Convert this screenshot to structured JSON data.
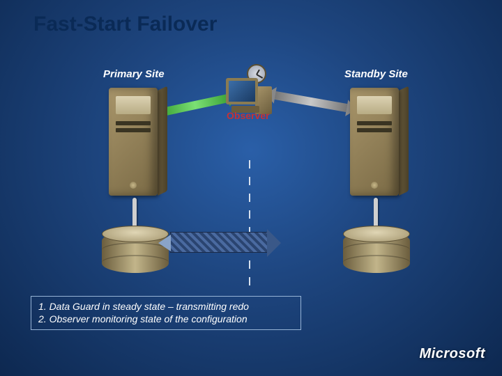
{
  "title": "Fast-Start Failover",
  "labels": {
    "primary": "Primary Site",
    "standby": "Standby Site",
    "observer": "Observer"
  },
  "caption": {
    "line1": "1. Data Guard in steady state – transmitting redo",
    "line2": "2. Observer monitoring state of the configuration"
  },
  "branding": {
    "text": "Microsoft"
  },
  "colors": {
    "accent_observer": "#c83232",
    "arrow_active": "#3da438",
    "arrow_inactive": "#8a8a8a"
  }
}
